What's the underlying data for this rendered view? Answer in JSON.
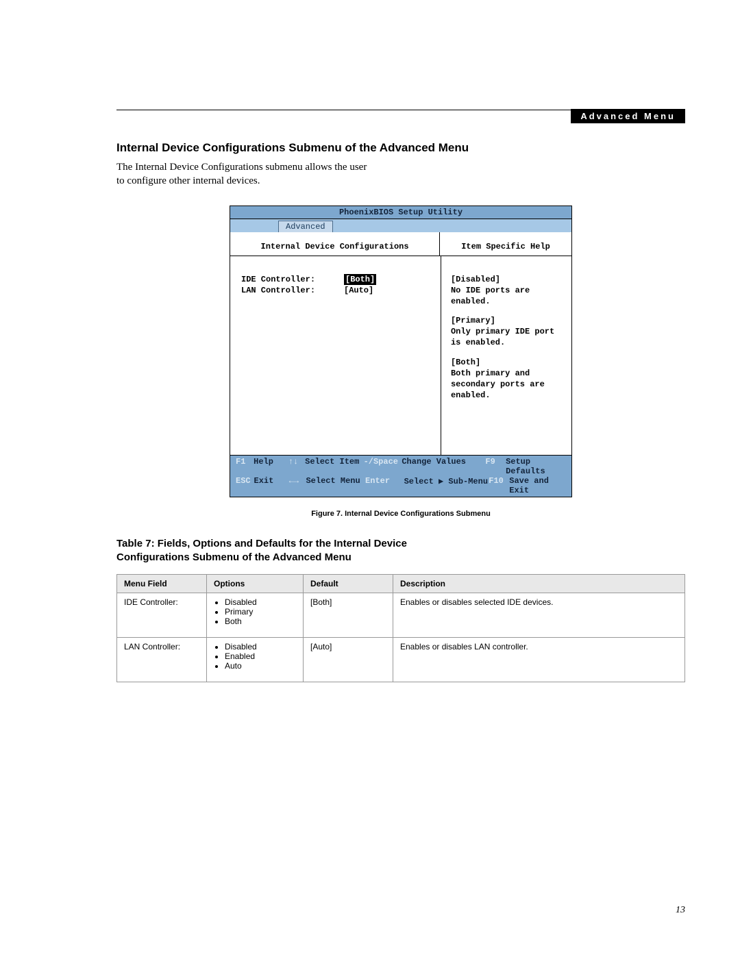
{
  "header": {
    "badge": "Advanced Menu"
  },
  "section": {
    "title": "Internal Device Configurations Submenu of the Advanced Menu",
    "intro": "The Internal Device Configurations submenu allows the user to configure other internal devices."
  },
  "bios": {
    "utility_title": "PhoenixBIOS Setup Utility",
    "tab": "Advanced",
    "left_title": "Internal Device Configurations",
    "right_title": "Item Specific Help",
    "fields": [
      {
        "label": "IDE Controller:",
        "value": "[Both]",
        "selected": true
      },
      {
        "label": "LAN Controller:",
        "value": "[Auto]",
        "selected": false
      }
    ],
    "help": [
      {
        "head": "[Disabled]",
        "body": "No IDE ports are enabled."
      },
      {
        "head": "[Primary]",
        "body": "Only primary IDE port is enabled."
      },
      {
        "head": "[Both]",
        "body": "Both primary and secondary ports are enabled."
      }
    ],
    "footer": {
      "r1": {
        "k1": "F1",
        "l1": "Help",
        "a": "↑↓",
        "al": "Select Item",
        "m": "-/Space",
        "ml": "Change Values",
        "k2": "F9",
        "l2": "Setup Defaults"
      },
      "r2": {
        "k1": "ESC",
        "l1": "Exit",
        "a": "←→",
        "al": "Select Menu",
        "m": "Enter",
        "ml": "Select ▶ Sub-Menu",
        "k2": "F10",
        "l2": "Save and Exit"
      }
    }
  },
  "figure_caption": "Figure 7.  Internal Device Configurations Submenu",
  "table": {
    "title": "Table 7: Fields, Options and Defaults for the Internal Device Configurations Submenu of the Advanced Menu",
    "headers": {
      "c1": "Menu Field",
      "c2": "Options",
      "c3": "Default",
      "c4": "Description"
    },
    "rows": [
      {
        "field": "IDE Controller:",
        "options": [
          "Disabled",
          "Primary",
          "Both"
        ],
        "default": "[Both]",
        "desc": "Enables or disables selected IDE devices."
      },
      {
        "field": "LAN Controller:",
        "options": [
          "Disabled",
          "Enabled",
          "Auto"
        ],
        "default": "[Auto]",
        "desc": "Enables or disables LAN controller."
      }
    ]
  },
  "page_number": "13"
}
